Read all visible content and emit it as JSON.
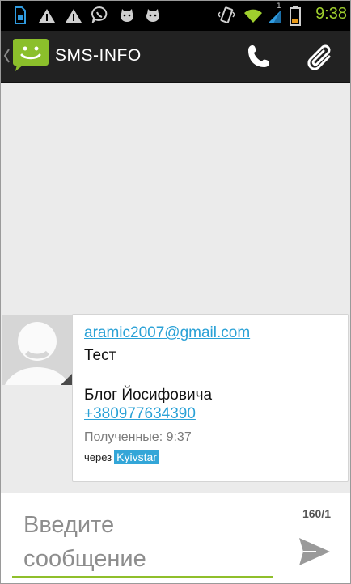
{
  "status_bar": {
    "time": "9:38",
    "icons": [
      "sim-card-icon",
      "warning-icon",
      "warning-icon",
      "viber-icon",
      "cat-icon",
      "cat-icon",
      "vibrate-icon",
      "wifi-icon",
      "signal-icon",
      "battery-icon"
    ],
    "signal_label": "1"
  },
  "action_bar": {
    "title": "SMS-INFO",
    "call_icon": "phone-icon",
    "attach_icon": "paperclip-icon"
  },
  "message": {
    "email": "aramic2007@gmail.com",
    "body_line1": "Тест",
    "body_line2": "Блог Йосифовича",
    "phone": "+380977634390",
    "received": "Полученные: 9:37",
    "via_label": "через",
    "carrier": "Kyivstar"
  },
  "composer": {
    "placeholder": "Введите\nсообщение",
    "counter": "160/1",
    "send_icon": "send-icon"
  },
  "colors": {
    "accent_green": "#9fcf2e",
    "link_blue": "#2aa1d6",
    "badge_blue": "#33a6d8"
  }
}
